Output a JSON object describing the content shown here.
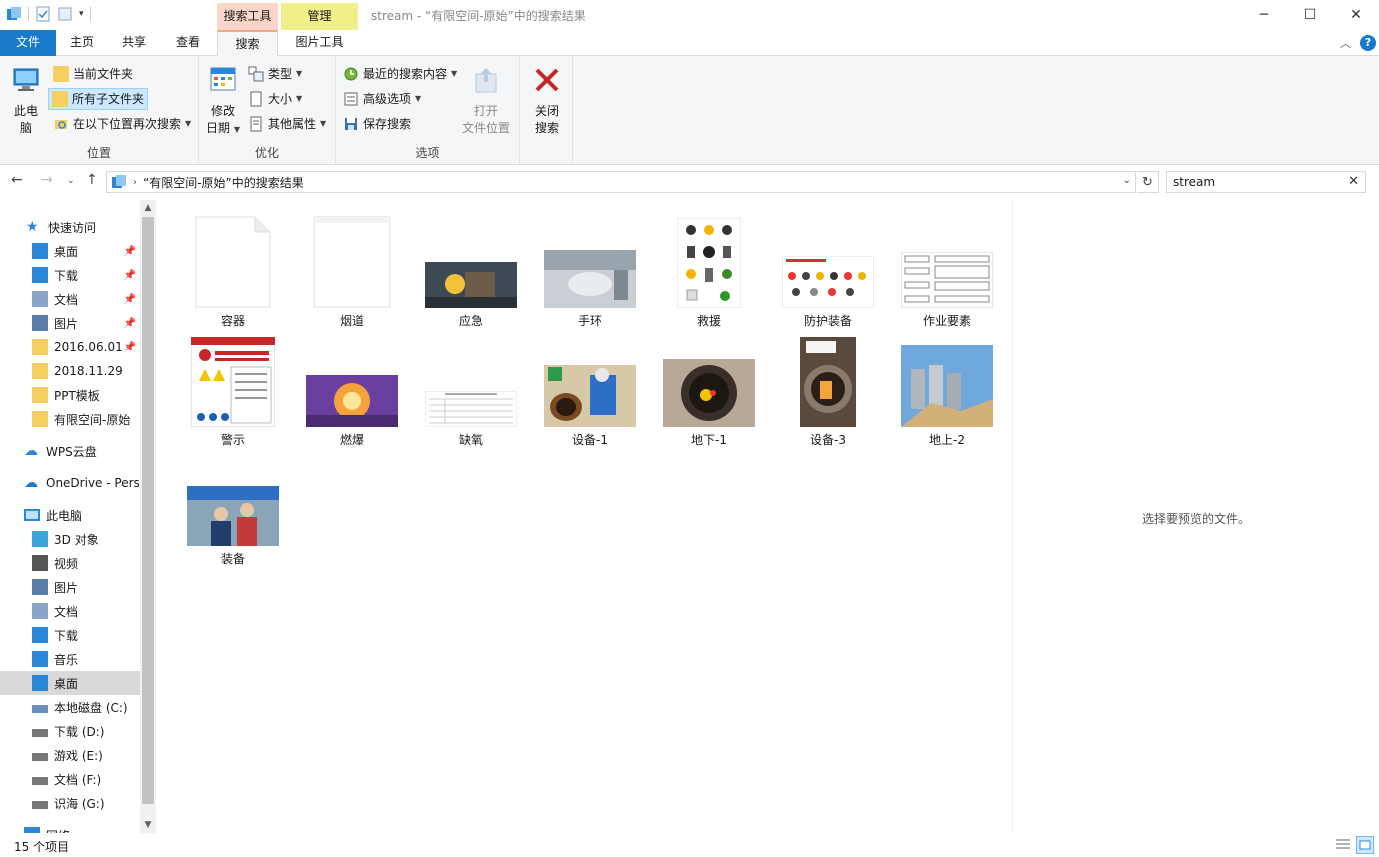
{
  "window": {
    "title": "stream - “有限空间-原始”中的搜索结果",
    "context_tab_search": "搜索工具",
    "context_tab_manage": "管理",
    "min": "─",
    "max": "☐",
    "close": "✕"
  },
  "tabs": {
    "file": "文件",
    "home": "主页",
    "share": "共享",
    "view": "查看",
    "search": "搜索",
    "picture_tools": "图片工具"
  },
  "ribbon": {
    "location": {
      "label": "位置",
      "this_pc": "此电\n脑",
      "this_pc_1": "此电",
      "this_pc_2": "脑",
      "current_folder": "当前文件夹",
      "all_subfolders": "所有子文件夹",
      "search_again": "在以下位置再次搜索"
    },
    "refine": {
      "label": "优化",
      "date_modified_1": "修改",
      "date_modified_2": "日期",
      "kind": "类型",
      "size": "大小",
      "other_props": "其他属性"
    },
    "options": {
      "label": "选项",
      "recent_searches": "最近的搜索内容",
      "advanced": "高级选项",
      "save_search": "保存搜索",
      "open_location_1": "打开",
      "open_location_2": "文件位置",
      "close_search_1": "关闭",
      "close_search_2": "搜索"
    }
  },
  "address": {
    "path": "“有限空间-原始”中的搜索结果",
    "search_value": "stream"
  },
  "navpane": {
    "quick_access": "快速访问",
    "items_quick": [
      {
        "label": "桌面",
        "icon": "desktop-icon"
      },
      {
        "label": "下载",
        "icon": "download-icon"
      },
      {
        "label": "文档",
        "icon": "documents-icon"
      },
      {
        "label": "图片",
        "icon": "pictures-icon"
      },
      {
        "label": "2016.06.01",
        "icon": "folder-icon"
      },
      {
        "label": "2018.11.29",
        "icon": "folder-icon"
      },
      {
        "label": "PPT模板",
        "icon": "folder-icon"
      },
      {
        "label": "有限空间-原始",
        "icon": "folder-icon"
      }
    ],
    "wps": "WPS云盘",
    "onedrive": "OneDrive - Perso",
    "this_pc": "此电脑",
    "items_pc": [
      {
        "label": "3D 对象",
        "icon": "3d-objects-icon"
      },
      {
        "label": "视频",
        "icon": "videos-icon"
      },
      {
        "label": "图片",
        "icon": "pictures-icon"
      },
      {
        "label": "文档",
        "icon": "documents-icon"
      },
      {
        "label": "下载",
        "icon": "download-icon"
      },
      {
        "label": "音乐",
        "icon": "music-icon"
      },
      {
        "label": "桌面",
        "icon": "desktop-icon"
      },
      {
        "label": "本地磁盘 (C:)",
        "icon": "drive-c-icon"
      },
      {
        "label": "下载 (D:)",
        "icon": "drive-icon"
      },
      {
        "label": "游戏 (E:)",
        "icon": "drive-icon"
      },
      {
        "label": "文档 (F:)",
        "icon": "drive-icon"
      },
      {
        "label": "识海 (G:)",
        "icon": "drive-icon"
      }
    ],
    "network": "网络"
  },
  "files": [
    {
      "name": "容器"
    },
    {
      "name": "烟道"
    },
    {
      "name": "应急"
    },
    {
      "name": "手环"
    },
    {
      "name": "救援"
    },
    {
      "name": "防护装备"
    },
    {
      "name": "作业要素"
    },
    {
      "name": "警示"
    },
    {
      "name": "燃爆"
    },
    {
      "name": "缺氧"
    },
    {
      "name": "设备-1"
    },
    {
      "name": "地下-1"
    },
    {
      "name": "设备-3"
    },
    {
      "name": "地上-2"
    },
    {
      "name": "装备"
    }
  ],
  "preview": {
    "message": "选择要预览的文件。"
  },
  "status": {
    "count": "15 个项目"
  }
}
